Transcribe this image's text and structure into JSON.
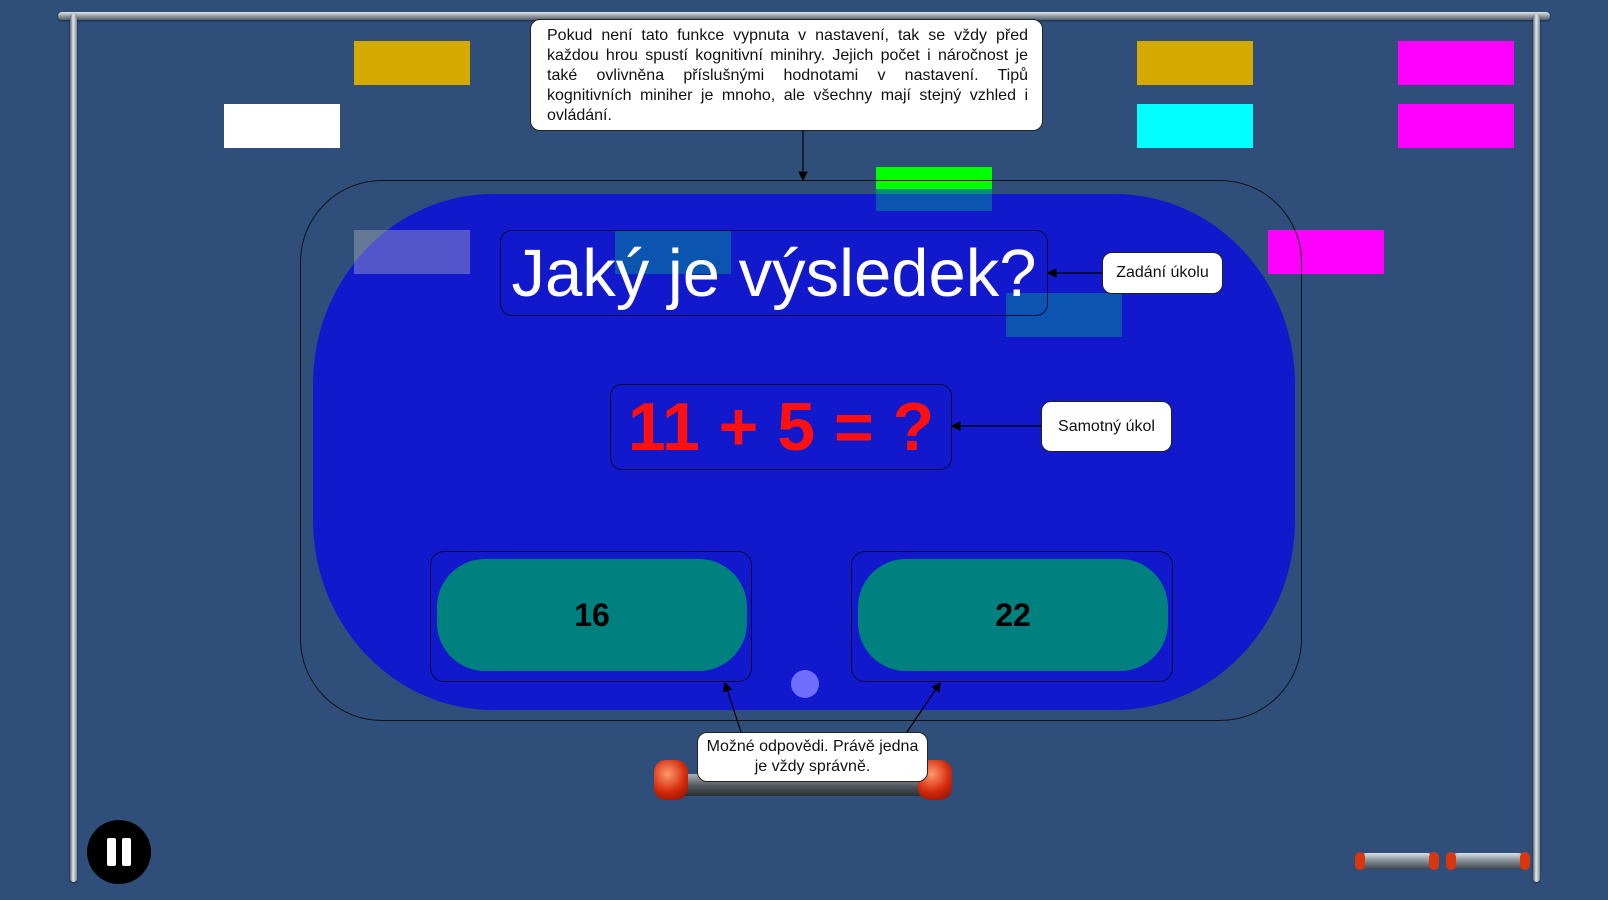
{
  "callouts": {
    "intro": "Pokud není tato funkce vypnuta v nastavení, tak se vždy před každou hrou spustí kognitivní minihry. Jejich počet i náročnost je také ovlivněna příslušnými hodnotami v nastavení. Tipů kognitivních miniher je mnoho, ale všechny mají stejný vzhled i ovládání.",
    "task_prompt": "Zadání úkolu",
    "task": "Samotný úkol",
    "answers": "Možné odpovědi. Právě jedna je vždy správně."
  },
  "game": {
    "title": "Jaký je výsledek?",
    "task": "11 + 5 = ?",
    "answers": [
      "16",
      "22"
    ]
  },
  "colors": {
    "background": "#2f4f7a",
    "game_area": "#1219cc",
    "answer_button": "#00807f",
    "task_text": "#ff1010",
    "brick_gold": "#d4aa00",
    "brick_white": "#ffffff",
    "brick_cyan": "#00ffff",
    "brick_magenta": "#ff00ff",
    "brick_green": "#00ff00"
  },
  "controls": {
    "pause_icon": "pause-icon",
    "lives_remaining": 2
  }
}
